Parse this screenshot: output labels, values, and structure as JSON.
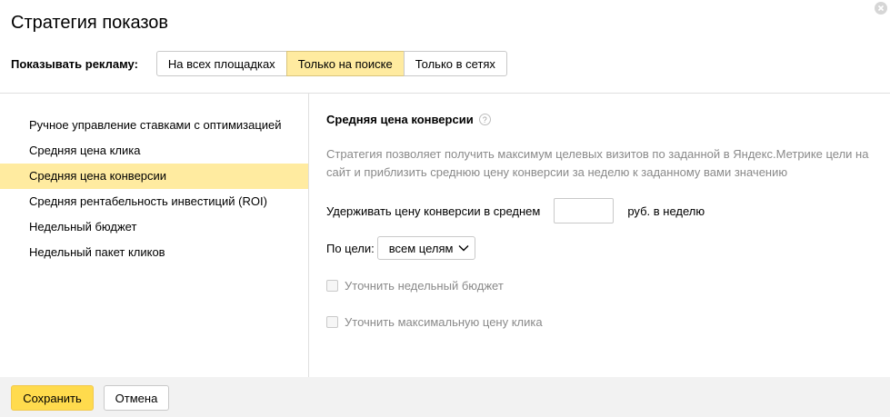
{
  "dialog": {
    "title": "Стратегия показов",
    "close_icon": "close-icon"
  },
  "show_ads": {
    "label": "Показывать рекламу:",
    "options": [
      {
        "label": "На всех площадках",
        "active": false
      },
      {
        "label": "Только на поиске",
        "active": true
      },
      {
        "label": "Только в сетях",
        "active": false
      }
    ]
  },
  "strategies": {
    "items": [
      {
        "label": "Ручное управление ставками с оптимизацией",
        "active": false
      },
      {
        "label": "Средняя цена клика",
        "active": false
      },
      {
        "label": "Средняя цена конверсии",
        "active": true
      },
      {
        "label": "Средняя рентабельность инвестиций (ROI)",
        "active": false
      },
      {
        "label": "Недельный бюджет",
        "active": false
      },
      {
        "label": "Недельный пакет кликов",
        "active": false
      }
    ]
  },
  "panel": {
    "title": "Средняя цена конверсии",
    "help_icon": "?",
    "description": "Стратегия позволяет получить максимум целевых визитов по заданной в Яндекс.Метрике цели на сайт и приблизить среднюю цену конверсии за неделю к заданному вами значению",
    "hold_label": "Удерживать цену конверсии в среднем",
    "hold_value": "",
    "hold_unit": "руб. в неделю",
    "goal_label": "По цели:",
    "goal_value": "всем целям",
    "check_weekly_budget": "Уточнить недельный бюджет",
    "check_max_click": "Уточнить максимальную цену клика"
  },
  "footer": {
    "save": "Сохранить",
    "cancel": "Отмена"
  },
  "colors": {
    "accent": "#ffdb4d",
    "selected": "#ffeba0"
  }
}
